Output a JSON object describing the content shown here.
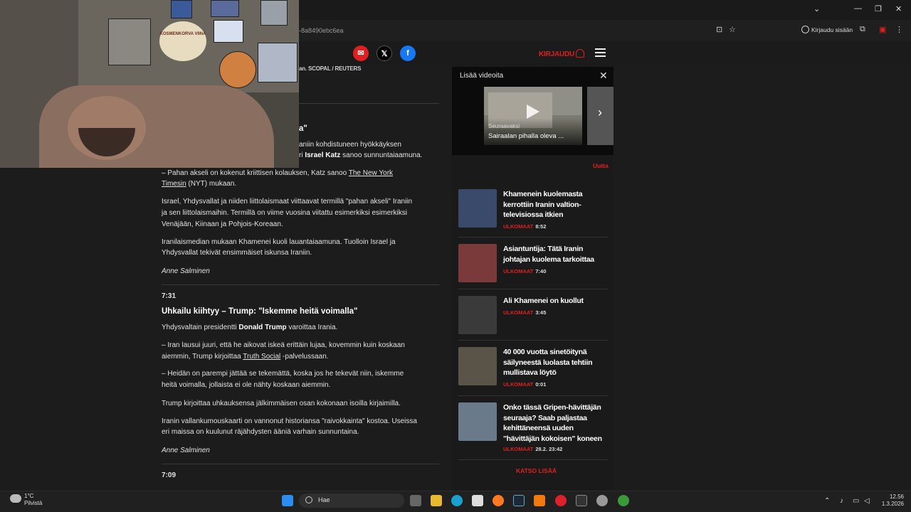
{
  "browser": {
    "url": "-8a8490ebc6ea",
    "login_label": "Kirjaudu sisään"
  },
  "site": {
    "login_link": "KIRJAUDU",
    "share": {
      "email": "✉",
      "x": "𝕏",
      "facebook": "f"
    }
  },
  "webcam": {
    "patch_text": "KOSMENKORVA VIINA"
  },
  "article": {
    "photo_caption": "an. SCOPAL / REUTERS",
    "heading_fragment": "a\"",
    "p1_line1": "aniin kohdistuneen hyökkäyksen",
    "p1_line2_pre": "ri ",
    "p1_line2_bold": "Israel Katz",
    "p1_line2_post": " sanoo sunnuntaiaamuna.",
    "quote_pre": "– Pahan akseli on kokenut kriittisen kolauksen, Katz sanoo ",
    "quote_link": "The New York",
    "quote_link2": "Timesin",
    "quote_post": " (NYT) mukaan.",
    "p2_l1": "Israel, Yhdysvallat ja niiden liittolaismaat viittaavat termillä \"pahan akseli\" Iraniin",
    "p2_l2": "ja sen liittolaismaihin. Termillä on viime vuosina viitattu esimerkiksi esimerkiksi",
    "p2_l3": "Venäjään, Kiinaan ja Pohjois-Koreaan.",
    "p3_l1": "Iranilaismedian mukaan Khamenei kuoli lauantaiaamuna. Tuolloin Israel ja",
    "p3_l2": "Yhdysvallat tekivät ensimmäiset iskunsa Iraniin.",
    "author1": "Anne Salminen",
    "time1": "7:31",
    "headline2": "Uhkailu kiihtyy – Trump: \"Iskemme heitä voimalla\"",
    "p4_pre": "Yhdysvaltain presidentti ",
    "p4_bold": "Donald Trump",
    "p4_post": " varoittaa Irania.",
    "p5_l1": "– Iran lausui juuri, että he aikovat iskeä erittäin lujaa, kovemmin kuin koskaan",
    "p5_l2_pre": "aiemmin, Trump kirjoittaa ",
    "p5_l2_link": "Truth Social",
    "p5_l2_post": " -palvelussaan.",
    "p6_l1": "– Heidän on parempi jättää se tekemättä, koska jos he tekevät niin, iskemme",
    "p6_l2": "heitä voimalla, jollaista ei ole nähty koskaan aiemmin.",
    "p7": "Trump kirjoittaa uhkauksensa jälkimmäisen osan kokonaan isoilla kirjaimilla.",
    "p8_l1": "Iranin vallankumouskaarti on vannonut historiansa \"raivokkainta\" kostoa. Useissa",
    "p8_l2": "eri maissa on kuulunut räjähdysten ääniä varhain sunnuntaina.",
    "author2": "Anne Salminen",
    "time2": "7:09"
  },
  "video_panel": {
    "title": "Lisää videoita",
    "next_label": "Seuraavaksi",
    "next_title": "Sairaalan pihalla oleva ..."
  },
  "sidebar": {
    "tab_label": "Uutta",
    "items": [
      {
        "title": "Khamenein kuolemasta kerrottiin Iranin valtion-televisiossa itkien",
        "tag": "ULKOMAAT",
        "time": "8:52"
      },
      {
        "title": "Asiantuntija: Tätä Iranin johtajan kuolema tarkoittaa",
        "tag": "ULKOMAAT",
        "time": "7:40"
      },
      {
        "title": "Ali Khamenei on kuollut",
        "tag": "ULKOMAAT",
        "time": "3:45"
      },
      {
        "title": "40 000 vuotta sinetöitynä säilyneestä luolasta tehtiin mullistava löytö",
        "tag": "ULKOMAAT",
        "time": "0:01"
      },
      {
        "title": "Onko tässä Gripen-hävittäjän seuraaja? Saab paljastaa kehittäneensä uuden \"hävittäjän kokoisen\" koneen",
        "tag": "ULKOMAAT",
        "time": "28.2. 23:42"
      }
    ],
    "more": "KATSO LISÄÄ"
  },
  "taskbar": {
    "temperature": "1°C",
    "weather": "Pilvistä",
    "search": "Hae",
    "time": "12.56",
    "date": "1.3.2026"
  },
  "colors": {
    "accent": "#e02020",
    "background": "#1c1c1c"
  }
}
